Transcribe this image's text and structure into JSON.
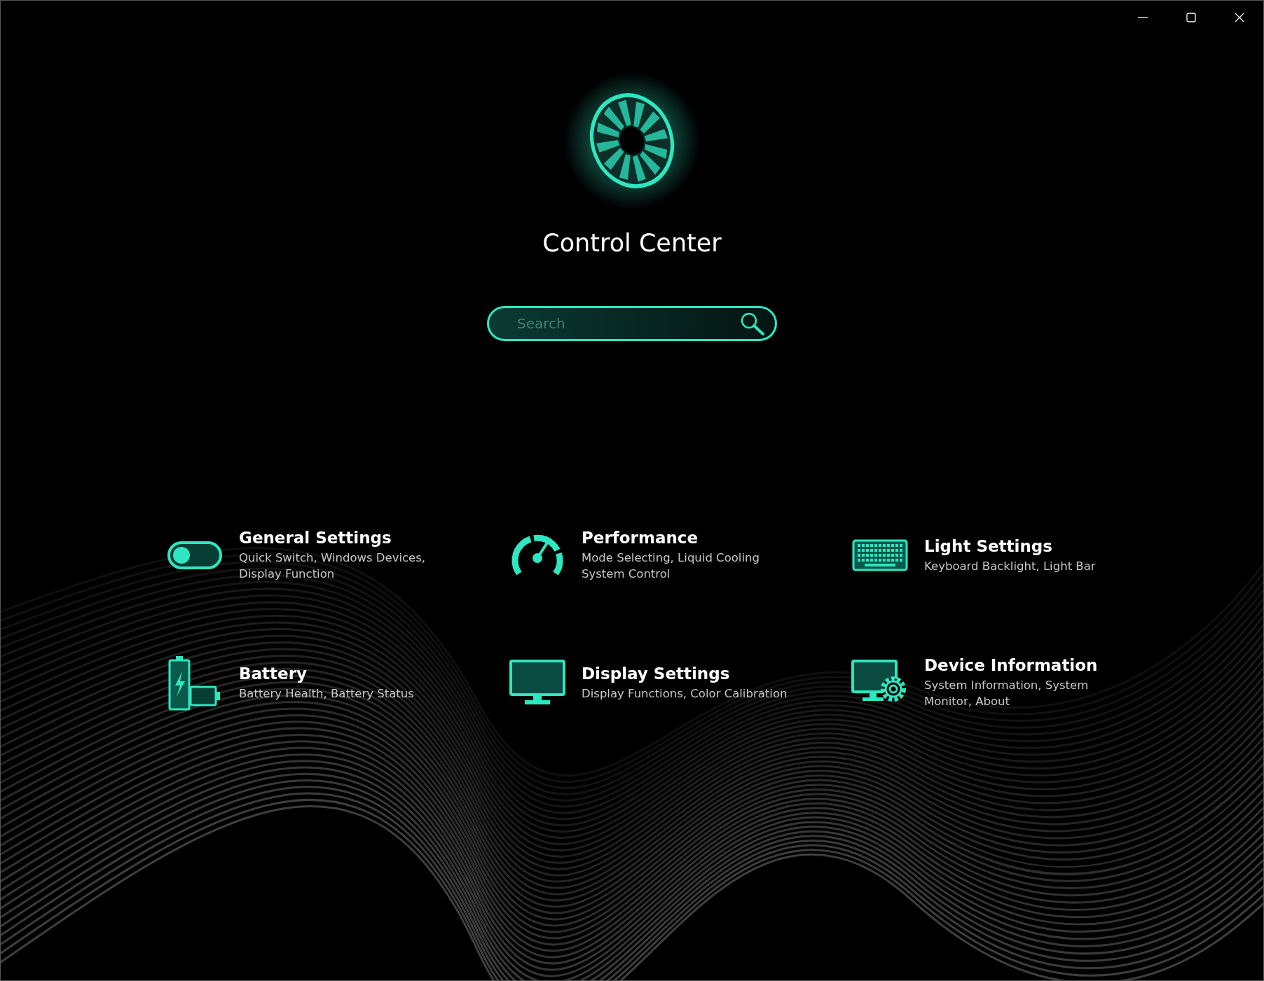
{
  "window": {
    "controls": [
      {
        "kind": "minimize"
      },
      {
        "kind": "maximize"
      },
      {
        "kind": "close"
      }
    ]
  },
  "title": "Control Center",
  "search": {
    "placeholder": "Search"
  },
  "items": [
    {
      "kind": "toggle",
      "title": "General Settings",
      "lines": [
        "Quick Switch, Windows Devices,",
        "Display Function"
      ]
    },
    {
      "kind": "gauge",
      "title": "Performance",
      "lines": [
        "Mode Selecting, Liquid Cooling",
        "System Control"
      ]
    },
    {
      "kind": "keyboard",
      "title": "Light Settings",
      "lines": [
        "Keyboard Backlight, Light Bar"
      ]
    },
    {
      "kind": "battery",
      "title": "Battery",
      "lines": [
        "Battery Health, Battery Status"
      ]
    },
    {
      "kind": "monitor",
      "title": "Display Settings",
      "lines": [
        "Display Functions, Color Calibration"
      ]
    },
    {
      "kind": "device",
      "title": "Device Information",
      "lines": [
        "System Information, System",
        "Monitor, About"
      ]
    }
  ]
}
